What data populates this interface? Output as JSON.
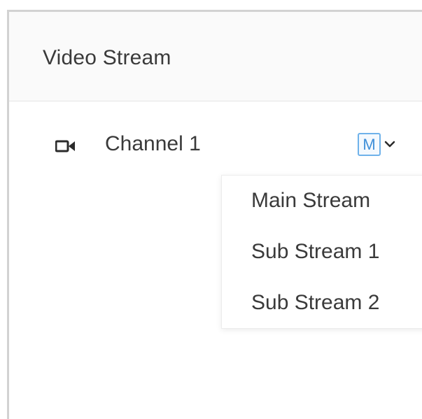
{
  "panel": {
    "title": "Video Stream"
  },
  "channel": {
    "label": "Channel 1",
    "icon": "video-camera-icon",
    "stream_badge": "M",
    "accent_color": "#3f8fd8"
  },
  "stream_menu": {
    "items": [
      {
        "label": "Main Stream"
      },
      {
        "label": "Sub Stream 1"
      },
      {
        "label": "Sub Stream 2"
      }
    ]
  }
}
